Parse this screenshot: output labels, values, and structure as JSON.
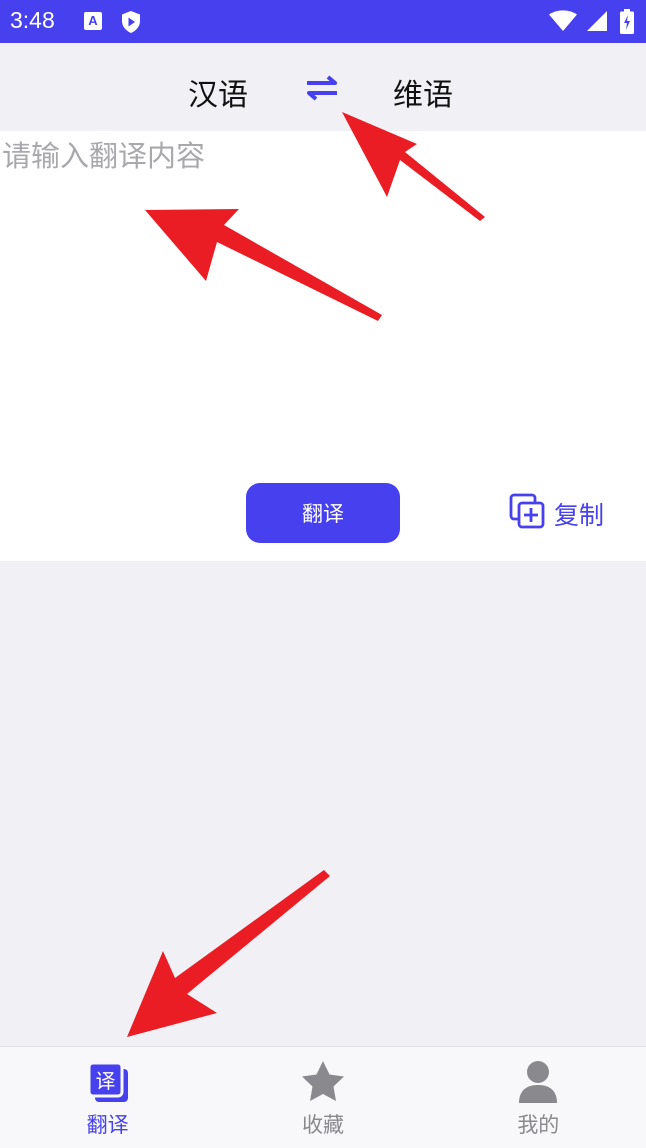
{
  "status_bar": {
    "time": "3:48",
    "a_icon_letter": "A",
    "icons": [
      "a-icon",
      "shield-icon",
      "wifi-icon",
      "signal-icon",
      "battery-icon"
    ]
  },
  "header": {
    "source_language": "汉语",
    "target_language": "维语",
    "swap_icon": "swap-arrows-icon"
  },
  "input": {
    "placeholder": "请输入翻译内容",
    "value": ""
  },
  "actions": {
    "translate_label": "翻译",
    "copy_label": "复制",
    "copy_icon": "copy-plus-icon"
  },
  "bottom_nav": {
    "items": [
      {
        "label": "翻译",
        "icon": "translate-icon",
        "icon_char": "译",
        "active": true
      },
      {
        "label": "收藏",
        "icon": "star-icon",
        "active": false
      },
      {
        "label": "我的",
        "icon": "person-icon",
        "active": false
      }
    ]
  },
  "colors": {
    "accent": "#4640ee",
    "background": "#f1f0f5",
    "card": "#ffffff",
    "annotation_arrow": "#ea1d25",
    "inactive_icon": "#8a8a8e"
  }
}
